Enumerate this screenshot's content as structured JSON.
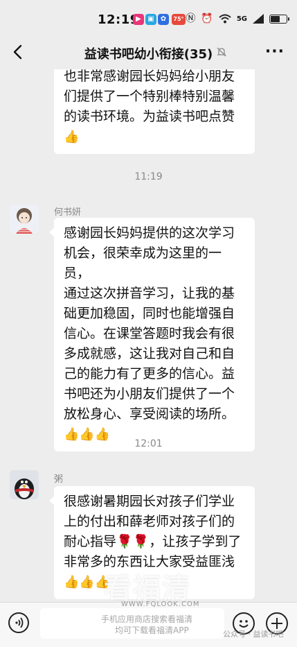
{
  "status_bar": {
    "time": "12:19",
    "app_badge": "75°",
    "signal": "5G",
    "battery_level": 0.6
  },
  "header": {
    "title": "益读书吧幼小衔接(35)",
    "more": "···"
  },
  "messages": {
    "m0": {
      "lines": [
        "也非常感谢园长妈妈给小朋友",
        "们提供了一个特别棒特别温馨",
        "的读书环境。为益读书吧点赞"
      ],
      "emoji": "👍"
    },
    "ts1": "11:19",
    "m1": {
      "sender": "何书妍",
      "lines": [
        "感谢园长妈妈提供的这次学习",
        "机会，很荣幸成为这里的一员，",
        "通过这次拼音学习，让我的基",
        "础更加稳固，同时也能增强自",
        "信心。在课堂答题时我会有很",
        "多成就感，这让我对自己和自",
        "己的能力有了更多的信心。益",
        "书吧还为小朋友们提供了一个",
        "放松身心、享受阅读的场所。"
      ],
      "emoji": "👍👍👍"
    },
    "ts2": "12:01",
    "m2": {
      "sender": "粥",
      "lines": [
        "很感谢暑期园长对孩子们学业",
        "上的付出和薛老师对孩子们的",
        "耐心指导🌹🌹，让孩子学到了",
        "非常多的东西让大家受益匪浅"
      ],
      "emoji": "👍👍👍"
    }
  },
  "watermark": {
    "brand": "看福清",
    "url": "WWW.FQLOOK.COM",
    "line1": "手机应用商店搜索看福清",
    "line2": "均可下载看福清APP",
    "source": "公众号 · 益读书吧"
  },
  "icons": {
    "back": "chevron-left-icon",
    "mute": "bell-off-icon",
    "voice": "voice-icon",
    "emoji": "emoji-icon",
    "plus": "plus-icon"
  }
}
